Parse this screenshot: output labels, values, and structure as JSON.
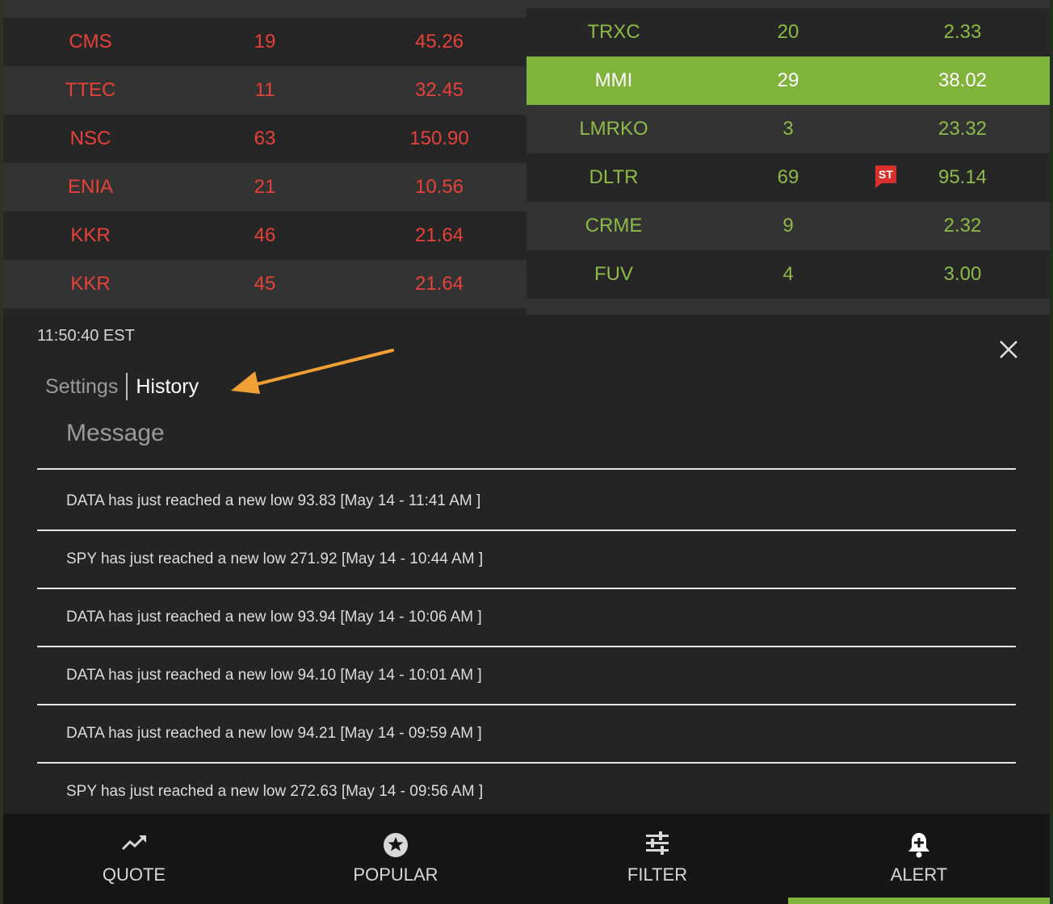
{
  "left_table": {
    "rows": [
      {
        "symbol": "CMS",
        "count": "19",
        "price": "45.26"
      },
      {
        "symbol": "TTEC",
        "count": "11",
        "price": "32.45"
      },
      {
        "symbol": "NSC",
        "count": "63",
        "price": "150.90"
      },
      {
        "symbol": "ENIA",
        "count": "21",
        "price": "10.56"
      },
      {
        "symbol": "KKR",
        "count": "46",
        "price": "21.64"
      },
      {
        "symbol": "KKR",
        "count": "45",
        "price": "21.64"
      }
    ]
  },
  "right_table": {
    "rows": [
      {
        "symbol": "TRXC",
        "count": "20",
        "price": "2.33"
      },
      {
        "symbol": "MMI",
        "count": "29",
        "price": "38.02"
      },
      {
        "symbol": "LMRKO",
        "count": "3",
        "price": "23.32"
      },
      {
        "symbol": "DLTR",
        "count": "69",
        "price": "95.14",
        "badge": "ST"
      },
      {
        "symbol": "CRME",
        "count": "9",
        "price": "2.32"
      },
      {
        "symbol": "FUV",
        "count": "4",
        "price": "3.00"
      }
    ],
    "selected_symbol": "MMI"
  },
  "panel": {
    "time": "11:50:40 EST",
    "tabs": {
      "settings": "Settings",
      "history": "History"
    },
    "active_tab": "History",
    "message_header": "Message",
    "messages": [
      "DATA has just reached a new low 93.83 [May 14 - 11:41 AM ]",
      "SPY has just reached a new low 271.92 [May 14 - 10:44 AM ]",
      "DATA has just reached a new low 93.94 [May 14 - 10:06 AM ]",
      "DATA has just reached a new low 94.10 [May 14 - 10:01 AM ]",
      "DATA has just reached a new low 94.21 [May 14 - 09:59 AM ]",
      "SPY has just reached a new low 272.63 [May 14 - 09:56 AM ]"
    ]
  },
  "nav": {
    "items": [
      {
        "label": "QUOTE",
        "icon": "trending-up-icon"
      },
      {
        "label": "POPULAR",
        "icon": "star-circle-icon"
      },
      {
        "label": "FILTER",
        "icon": "sliders-icon"
      },
      {
        "label": "ALERT",
        "icon": "bell-plus-icon"
      }
    ],
    "active": "ALERT"
  },
  "colors": {
    "loss": "#e8413a",
    "gain": "#8dbb48",
    "selected_row": "#7fb33a",
    "annotation_arrow": "#f0a035"
  }
}
